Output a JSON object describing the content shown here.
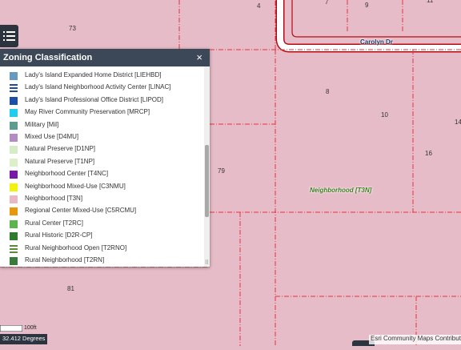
{
  "map": {
    "parcel_numbers": {
      "p73": "73",
      "p4": "4",
      "p7": "7",
      "p9": "9",
      "p11": "11",
      "p8": "8",
      "p10": "10",
      "p14": "14",
      "p16": "16",
      "p79": "79",
      "p81": "81"
    },
    "road_label": "Carolyn Dr",
    "zone_label": "Neighborhood [T3N]",
    "zone_fill_color": "#e6bcc8",
    "parcel_line_color": "#e8323c",
    "road_color": "#ffffff",
    "road_casing_color": "#b40c14"
  },
  "legend_toggle": {
    "icon": "legend-list-icon"
  },
  "panel": {
    "title": "Zoning Classification",
    "close_glyph": "×",
    "resize_glyph": "⠿",
    "items": [
      {
        "label": "Lady's Island Expanded Home District [LIEHBD]",
        "color": "#6699bb",
        "pattern": "solid"
      },
      {
        "label": "Lady's Island Neighborhood Activity Center [LINAC]",
        "color": "#1f4e96",
        "pattern": "stripes"
      },
      {
        "label": "Lady's Island Professional Office District [LIPOD]",
        "color": "#1e4fa8",
        "pattern": "solid"
      },
      {
        "label": "May River Community Preservation [MRCP]",
        "color": "#22ccee",
        "pattern": "solid"
      },
      {
        "label": "Military [Mil]",
        "color": "#5e9c8e",
        "pattern": "solid"
      },
      {
        "label": "Mixed Use [D4MU]",
        "color": "#b48cc4",
        "pattern": "solid"
      },
      {
        "label": "Natural Preserve [D1NP]",
        "color": "#d6ecc6",
        "pattern": "solid"
      },
      {
        "label": "Natural Preserve [T1NP]",
        "color": "#dcefc8",
        "pattern": "solid"
      },
      {
        "label": "Neighborhood Center [T4NC]",
        "color": "#7a1aa8",
        "pattern": "solid"
      },
      {
        "label": "Neighborhood Mixed-Use [C3NMU]",
        "color": "#f4f20c",
        "pattern": "solid"
      },
      {
        "label": "Neighborhood [T3N]",
        "color": "#e8b8c4",
        "pattern": "solid"
      },
      {
        "label": "Regional Center Mixed-Use [C5RCMU]",
        "color": "#e8980c",
        "pattern": "solid"
      },
      {
        "label": "Rural Center [T2RC]",
        "color": "#5cb44c",
        "pattern": "solid"
      },
      {
        "label": "Rural Historic [D2R-CP]",
        "color": "#2e7a2e",
        "pattern": "solid"
      },
      {
        "label": "Rural Neighborhood Open [T2RNO]",
        "color": "#5a8a3a",
        "pattern": "stripes"
      },
      {
        "label": "Rural Neighborhood [T2RN]",
        "color": "#3a7a3a",
        "pattern": "solid"
      }
    ]
  },
  "scale": {
    "label": "100ft",
    "units": "3ML5"
  },
  "coords": {
    "text": "32.412 Degrees"
  },
  "attribution": {
    "text": "Esri Community Maps Contributors"
  }
}
